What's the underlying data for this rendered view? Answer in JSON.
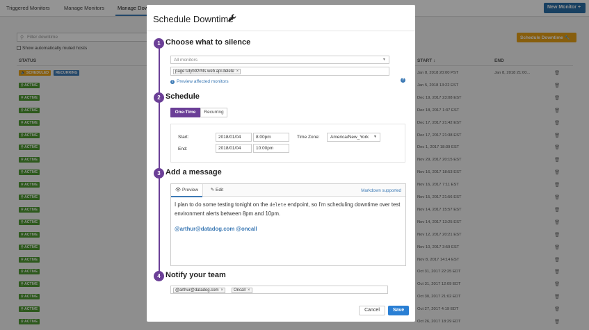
{
  "topnav": {
    "tabs": [
      "Triggered Monitors",
      "Manage Monitors",
      "Manage Downtime"
    ],
    "new_monitor": "New Monitor +"
  },
  "page": {
    "filter_placeholder": "Filter downtime",
    "muted_label": "Show automatically muted hosts",
    "schedule_button": "Schedule Downtime",
    "col_status": "STATUS",
    "col_start": "START",
    "col_end": "END",
    "rows": [
      {
        "badge": "SCHEDULED",
        "recurring": "RECURRING",
        "start": "Jan 8, 2018 20:00 PST",
        "end": "Jan 8, 2018 21:00..."
      },
      {
        "badge": "ACTIVE",
        "start": "Jan 5, 2018 13:22 EST",
        "end": ""
      },
      {
        "badge": "ACTIVE",
        "start": "Dec 19, 2017 23:08 EST",
        "end": ""
      },
      {
        "badge": "ACTIVE",
        "start": "Dec 18, 2017 1:37 EST",
        "end": ""
      },
      {
        "badge": "ACTIVE",
        "start": "Dec 17, 2017 21:42 EST",
        "end": ""
      },
      {
        "badge": "ACTIVE",
        "start": "Dec 17, 2017 21:38 EST",
        "end": ""
      },
      {
        "badge": "ACTIVE",
        "start": "Dec 1, 2017 18:39 EST",
        "end": ""
      },
      {
        "badge": "ACTIVE",
        "start": "Nov 29, 2017 20:15 EST",
        "end": ""
      },
      {
        "badge": "ACTIVE",
        "start": "Nov 16, 2017 18:53 EST",
        "end": ""
      },
      {
        "badge": "ACTIVE",
        "start": "Nov 16, 2017 7:11 EST",
        "end": ""
      },
      {
        "badge": "ACTIVE",
        "start": "Nov 15, 2017 21:56 EST",
        "end": ""
      },
      {
        "badge": "ACTIVE",
        "start": "Nov 14, 2017 15:57 EST",
        "end": ""
      },
      {
        "badge": "ACTIVE",
        "start": "Nov 14, 2017 13:25 EST",
        "end": ""
      },
      {
        "badge": "ACTIVE",
        "start": "Nov 12, 2017 20:21 EST",
        "end": ""
      },
      {
        "badge": "ACTIVE",
        "start": "Nov 10, 2017 3:59 EST",
        "end": ""
      },
      {
        "badge": "ACTIVE",
        "start": "Nov 8, 2017 14:14 EST",
        "end": ""
      },
      {
        "badge": "ACTIVE",
        "start": "Oct 31, 2017 22:25 EDT",
        "end": ""
      },
      {
        "badge": "ACTIVE",
        "start": "Oct 31, 2017 12:09 EDT",
        "end": ""
      },
      {
        "badge": "ACTIVE",
        "start": "Oct 30, 2017 21:02 EDT",
        "end": ""
      },
      {
        "badge": "ACTIVE",
        "start": "Oct 27, 2017 4:19 EDT",
        "end": ""
      },
      {
        "badge": "ACTIVE",
        "start": "Oct 26, 2017 18:29 EDT",
        "end": ""
      }
    ]
  },
  "modal": {
    "title": "Schedule Downtime",
    "step1": {
      "num": "1",
      "title": "Choose what to silence",
      "monitor_select": "All monitors",
      "scope_tag": "page:sdyb92rhts.web.api.delete",
      "tag_remove": "×",
      "preview_link": "Preview affected monitors",
      "help": "?"
    },
    "step2": {
      "num": "2",
      "title": "Schedule",
      "one_time": "One-Time",
      "recurring": "Recurring",
      "start_label": "Start:",
      "end_label": "End:",
      "start_date": "2018/01/04",
      "start_time": "8:00pm",
      "end_date": "2018/01/04",
      "end_time": "10:00pm",
      "tz_label": "Time Zone:",
      "tz_value": "America/New_York"
    },
    "step3": {
      "num": "3",
      "title": "Add a message",
      "tab_preview": "Preview",
      "tab_edit": "Edit",
      "markdown_link": "Markdown supported",
      "msg_part1": "I plan to do some testing tonight on the ",
      "msg_code": "delete",
      "msg_part2": " endpoint, so I'm scheduling downtime over test environment alerts between 8pm and 10pm.",
      "mentions": "@arthur@datadog.com @oncall"
    },
    "step4": {
      "num": "4",
      "title": "Notify your team",
      "recipients": [
        "@arthur@datadog.com",
        "Oncall"
      ]
    },
    "cancel": "Cancel",
    "save": "Save"
  }
}
